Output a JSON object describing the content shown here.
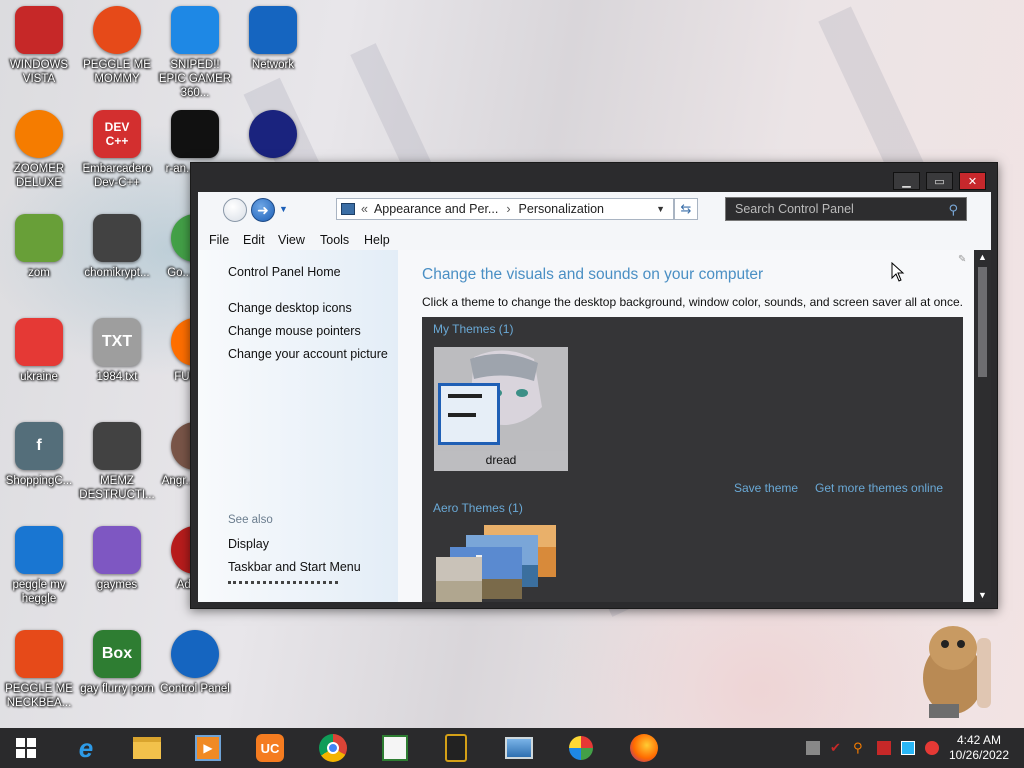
{
  "desktop_icons": [
    {
      "label": "WINDOWS VISTA",
      "color": "#c62828"
    },
    {
      "label": "PEGGLE ME MOMMY",
      "color": "#e64a19"
    },
    {
      "label": "SNIPED!! EPIC GAMER 360...",
      "color": "#1e88e5"
    },
    {
      "label": "Network",
      "color": "#1565c0"
    },
    {
      "label": "ZOOMER DELUXE",
      "color": "#f57c00"
    },
    {
      "label": "Embarcadero Dev-C++",
      "color": "#d32f2f",
      "glyph": "DEV C++"
    },
    {
      "label": "r-an... par...",
      "color": "#111111"
    },
    {
      "label": "",
      "color": "#1a237e"
    },
    {
      "label": "zom",
      "color": "#689f38"
    },
    {
      "label": "chomikrypt...",
      "color": "#424242"
    },
    {
      "label": "Go... Chr...",
      "color": "#43a047"
    },
    {
      "label": "ukraine",
      "color": "#e53935"
    },
    {
      "label": "1984.txt",
      "color": "#9e9e9e",
      "glyph": "TXT"
    },
    {
      "label": "FURR...",
      "color": "#ff6f00"
    },
    {
      "label": "ShoppingC...",
      "color": "#546e7a",
      "glyph": "f"
    },
    {
      "label": "MEMZ DESTRUCTI...",
      "color": "#424242"
    },
    {
      "label": "Angr... Sea...",
      "color": "#795548"
    },
    {
      "label": "peggle my heggle",
      "color": "#1976d2"
    },
    {
      "label": "gaymes",
      "color": "#7e57c2"
    },
    {
      "label": "Adob...",
      "color": "#b71c1c"
    },
    {
      "label": "PEGGLE ME NECKBEA...",
      "color": "#e64a19"
    },
    {
      "label": "gay flurry porn",
      "color": "#2e7d32",
      "glyph": "Box"
    },
    {
      "label": "Control Panel",
      "color": "#1565c0"
    }
  ],
  "window": {
    "controls": {
      "minimize": "▁",
      "maximize": "▭",
      "close": "✕"
    },
    "breadcrumb": {
      "chevrons": "«",
      "parent": "Appearance and Per...",
      "separator": "›",
      "current": "Personalization"
    },
    "search_placeholder": "Search Control Panel",
    "menu": [
      "File",
      "Edit",
      "View",
      "Tools",
      "Help"
    ],
    "left_pane": {
      "home": "Control Panel Home",
      "links": [
        "Change desktop icons",
        "Change mouse pointers",
        "Change your account picture"
      ],
      "see_also_title": "See also",
      "see_also": [
        "Display",
        "Taskbar and Start Menu"
      ]
    },
    "content": {
      "heading": "Change the visuals and sounds on your computer",
      "description": "Click a theme to change the desktop background, window color, sounds, and screen saver all at once.",
      "my_themes_title": "My Themes (1)",
      "my_theme_name": "dread",
      "save_theme": "Save theme",
      "get_more": "Get more themes online",
      "aero_title": "Aero Themes (1)"
    }
  },
  "taskbar": {
    "time": "4:42 AM",
    "date": "10/26/2022"
  },
  "colors": {
    "accent_link": "#6aa9d6",
    "heading": "#4a8fc4",
    "taskbar": "#2a2a2c"
  }
}
